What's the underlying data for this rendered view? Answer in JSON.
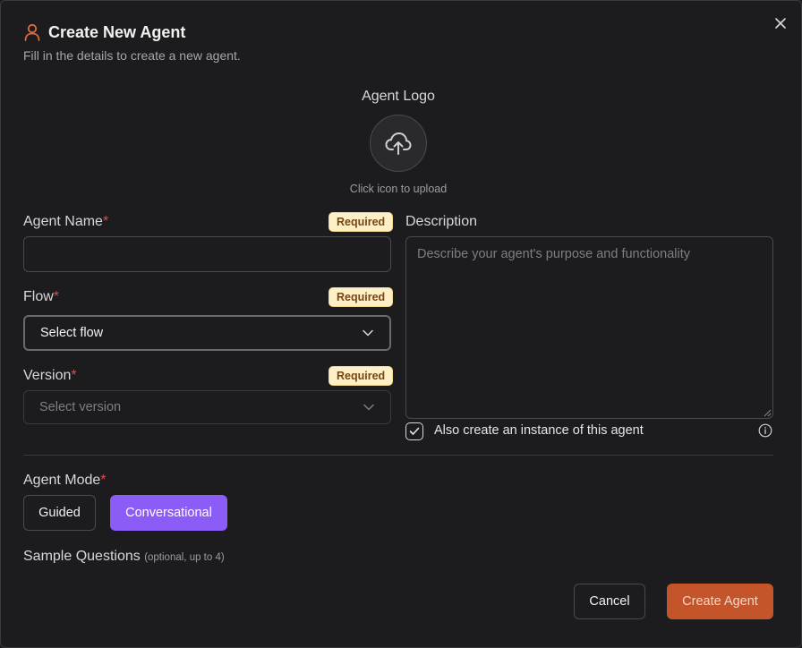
{
  "dialog": {
    "title": "Create New Agent",
    "subtitle": "Fill in the details to create a new agent."
  },
  "logo": {
    "label": "Agent Logo",
    "hint": "Click icon to upload"
  },
  "fields": {
    "agent_name": {
      "label": "Agent Name",
      "required_mark": "*",
      "badge": "Required",
      "value": ""
    },
    "flow": {
      "label": "Flow",
      "required_mark": "*",
      "badge": "Required",
      "value": "Select flow"
    },
    "version": {
      "label": "Version",
      "required_mark": "*",
      "badge": "Required",
      "placeholder": "Select version"
    },
    "description": {
      "label": "Description",
      "placeholder": "Describe your agent's purpose and functionality"
    }
  },
  "instance_checkbox": {
    "label": "Also create an instance of this agent",
    "checked": true
  },
  "agent_mode": {
    "label": "Agent Mode",
    "required_mark": "*",
    "options": [
      "Guided",
      "Conversational"
    ],
    "selected": "Conversational"
  },
  "sample_questions": {
    "label": "Sample Questions",
    "note": "(optional, up to 4)"
  },
  "footer": {
    "cancel": "Cancel",
    "create": "Create Agent"
  },
  "colors": {
    "accent_orange": "#c4542a",
    "accent_purple": "#8b5cf6",
    "badge_bg": "#fdf0c7",
    "required_star": "#e5484d"
  },
  "icons": [
    "person-icon",
    "close-icon",
    "upload-cloud-icon",
    "chevron-down-icon",
    "check-icon",
    "info-icon"
  ]
}
